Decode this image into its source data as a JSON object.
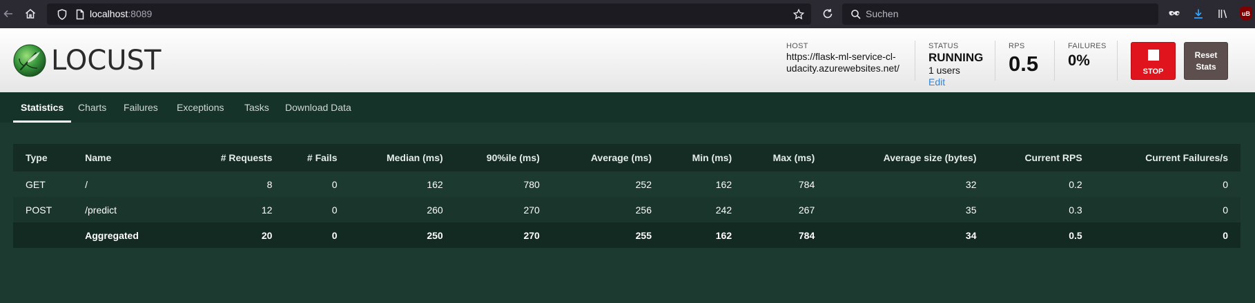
{
  "browser": {
    "url_host": "localhost",
    "url_port": ":8089",
    "search_placeholder": "Suchen"
  },
  "header": {
    "logo_text": "LOCUST",
    "host_label": "HOST",
    "host_value": "https://flask-ml-service-cl-udacity.azurewebsites.net/",
    "status_label": "STATUS",
    "status_value": "RUNNING",
    "users_value": "1 users",
    "edit_label": "Edit",
    "rps_label": "RPS",
    "rps_value": "0.5",
    "failures_label": "FAILURES",
    "failures_value": "0%",
    "stop_label": "STOP",
    "reset_label": "Reset Stats"
  },
  "tabs": [
    {
      "label": "Statistics",
      "active": true
    },
    {
      "label": "Charts",
      "active": false
    },
    {
      "label": "Failures",
      "active": false
    },
    {
      "label": "Exceptions",
      "active": false
    },
    {
      "label": "Tasks",
      "active": false
    },
    {
      "label": "Download Data",
      "active": false
    }
  ],
  "stats": {
    "columns": [
      "Type",
      "Name",
      "# Requests",
      "# Fails",
      "Median (ms)",
      "90%ile (ms)",
      "Average (ms)",
      "Min (ms)",
      "Max (ms)",
      "Average size (bytes)",
      "Current RPS",
      "Current Failures/s"
    ],
    "rows": [
      [
        "GET",
        "/",
        "8",
        "0",
        "162",
        "780",
        "252",
        "162",
        "784",
        "32",
        "0.2",
        "0"
      ],
      [
        "POST",
        "/predict",
        "12",
        "0",
        "260",
        "270",
        "256",
        "242",
        "267",
        "35",
        "0.3",
        "0"
      ],
      [
        "",
        "Aggregated",
        "20",
        "0",
        "250",
        "270",
        "255",
        "162",
        "784",
        "34",
        "0.5",
        "0"
      ]
    ]
  },
  "colors": {
    "page_bg": "#1c3a2f",
    "tab_bar_bg": "#16332a",
    "stop_red": "#e0141c",
    "reset_brown": "#5e4f4f",
    "edit_link": "#2f86d6"
  }
}
